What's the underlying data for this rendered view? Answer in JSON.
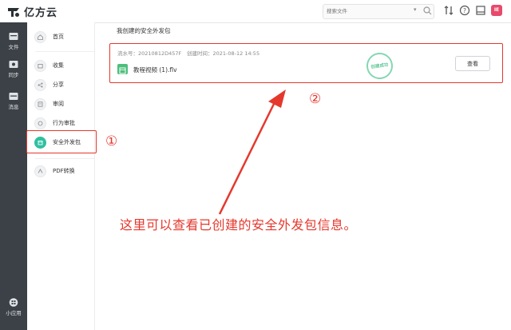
{
  "app": {
    "name": "亿方云"
  },
  "search": {
    "placeholder": "搜索文件"
  },
  "user": {
    "avatar_text": "IE"
  },
  "rail": {
    "items": [
      {
        "label": "文件"
      },
      {
        "label": "同步"
      },
      {
        "label": "消息"
      },
      {
        "label": "小应用"
      }
    ]
  },
  "sidebar": {
    "items": [
      {
        "label": "首页"
      },
      {
        "label": "收集"
      },
      {
        "label": "分享"
      },
      {
        "label": "审阅"
      },
      {
        "label": "行为审批"
      },
      {
        "label": "安全外发包"
      },
      {
        "label": "PDF转换"
      }
    ]
  },
  "main": {
    "title": "我创建的安全外发包",
    "card": {
      "serial": "流水号：20210812D457F",
      "created": "创建时间：2021-08-12 14:55",
      "file_name": "教程视频 (1).flv",
      "stamp": "创建成功",
      "view_label": "查看"
    }
  },
  "annotations": {
    "marker_one": "①",
    "marker_two": "②",
    "caption": "这里可以查看已创建的安全外发包信息。"
  },
  "colors": {
    "accent": "#2fc0a0",
    "annotation": "#e5382d",
    "rail_bg": "#3b4147"
  }
}
